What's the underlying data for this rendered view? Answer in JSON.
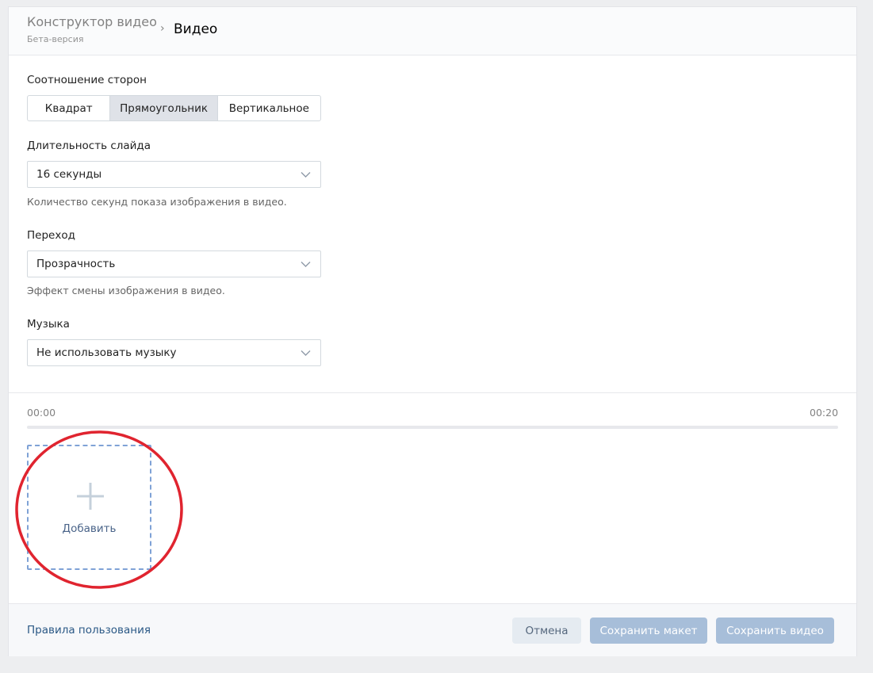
{
  "header": {
    "app_title": "Конструктор видео",
    "app_subtitle": "Бета-версия",
    "separator": "›",
    "current_page": "Видео"
  },
  "aspect_ratio": {
    "label": "Соотношение сторон",
    "options": [
      "Квадрат",
      "Прямоугольник",
      "Вертикальное"
    ],
    "selected": "Прямоугольник"
  },
  "slide_duration": {
    "label": "Длительность слайда",
    "value": "16 секунды",
    "hint": "Количество секунд показа изображения в видео."
  },
  "transition": {
    "label": "Переход",
    "value": "Прозрачность",
    "hint": "Эффект смены изображения в видео."
  },
  "music": {
    "label": "Музыка",
    "value": "Не использовать музыку"
  },
  "timeline": {
    "start_time": "00:00",
    "end_time": "00:20"
  },
  "add_tile": {
    "label": "Добавить"
  },
  "footer": {
    "rules_link": "Правила пользования",
    "cancel_label": "Отмена",
    "save_layout_label": "Сохранить макет",
    "save_video_label": "Сохранить видео"
  },
  "colors": {
    "accent_link": "#2a5885",
    "primary_button": "#a7bed9",
    "annotation_circle": "#e0242f",
    "dashed_border": "#7fa2d6"
  }
}
